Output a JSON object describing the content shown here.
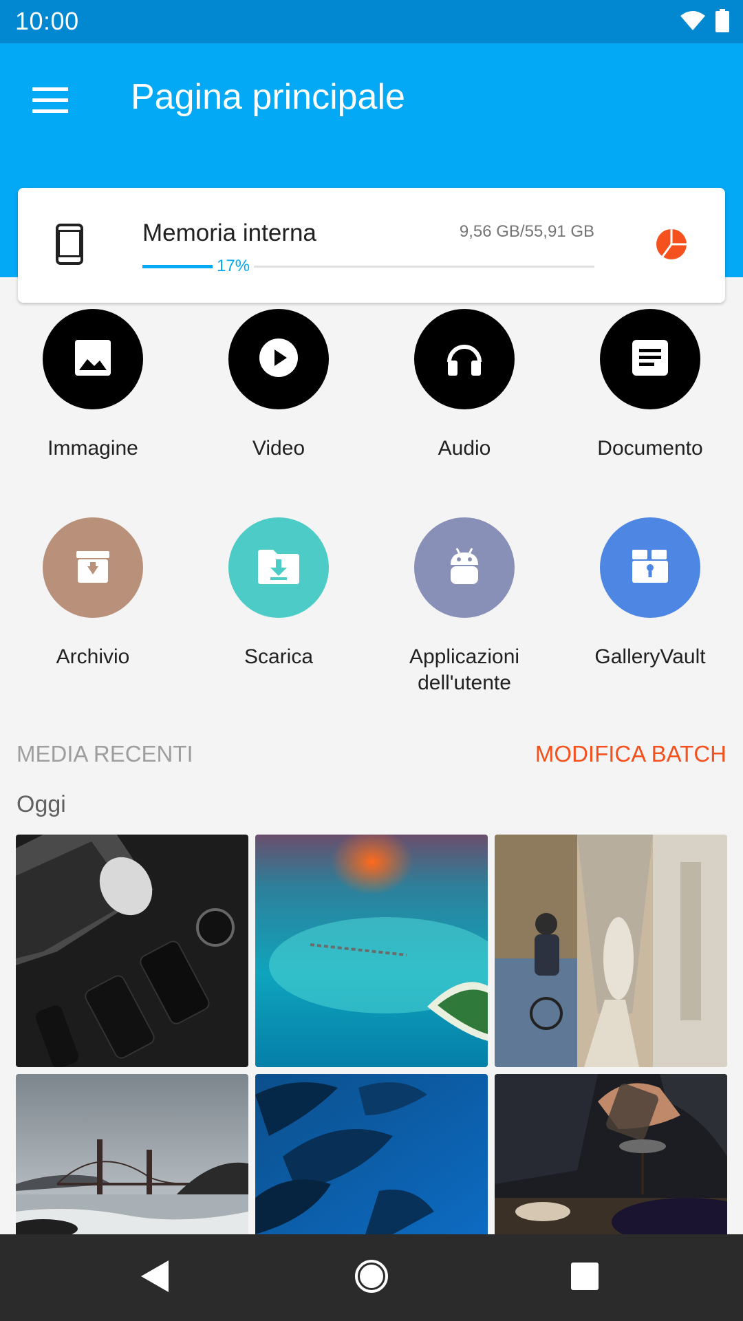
{
  "status_bar": {
    "time": "10:00",
    "icons": [
      "wifi-icon",
      "battery-icon"
    ]
  },
  "app_bar": {
    "title": "Pagina principale",
    "menu_icon": "menu-icon"
  },
  "storage": {
    "label": "Memoria interna",
    "size": "9,56 GB/55,91 GB",
    "percent_text": "17%",
    "percent": 17,
    "device_icon": "phone-icon",
    "chart_icon": "pie-chart-icon"
  },
  "categories": [
    {
      "label": "Immagine",
      "icon": "image-icon",
      "color": "#000000"
    },
    {
      "label": "Video",
      "icon": "play-icon",
      "color": "#000000"
    },
    {
      "label": "Audio",
      "icon": "headphones-icon",
      "color": "#000000"
    },
    {
      "label": "Documento",
      "icon": "document-icon",
      "color": "#000000"
    },
    {
      "label": "Archivio",
      "icon": "archive-icon",
      "color": "#b9917b"
    },
    {
      "label": "Scarica",
      "icon": "download-folder-icon",
      "color": "#4dcbc7"
    },
    {
      "label": "Applicazioni dell'utente",
      "icon": "android-icon",
      "color": "#8890b8"
    },
    {
      "label": "GalleryVault",
      "icon": "vault-icon",
      "color": "#4d86e3"
    }
  ],
  "recent": {
    "title": "MEDIA RECENTI",
    "batch_label": "MODIFICA BATCH",
    "group_label": "Oggi",
    "accent_color": "#f4511e",
    "thumbnails": [
      "desk-devices-photo",
      "tropical-island-photo",
      "alley-cyclist-photo",
      "golden-gate-bridge-photo",
      "blue-leaves-photo",
      "pouring-tea-photo"
    ]
  },
  "nav_bar": {
    "icons": [
      "back-icon",
      "home-icon",
      "recents-icon"
    ]
  }
}
